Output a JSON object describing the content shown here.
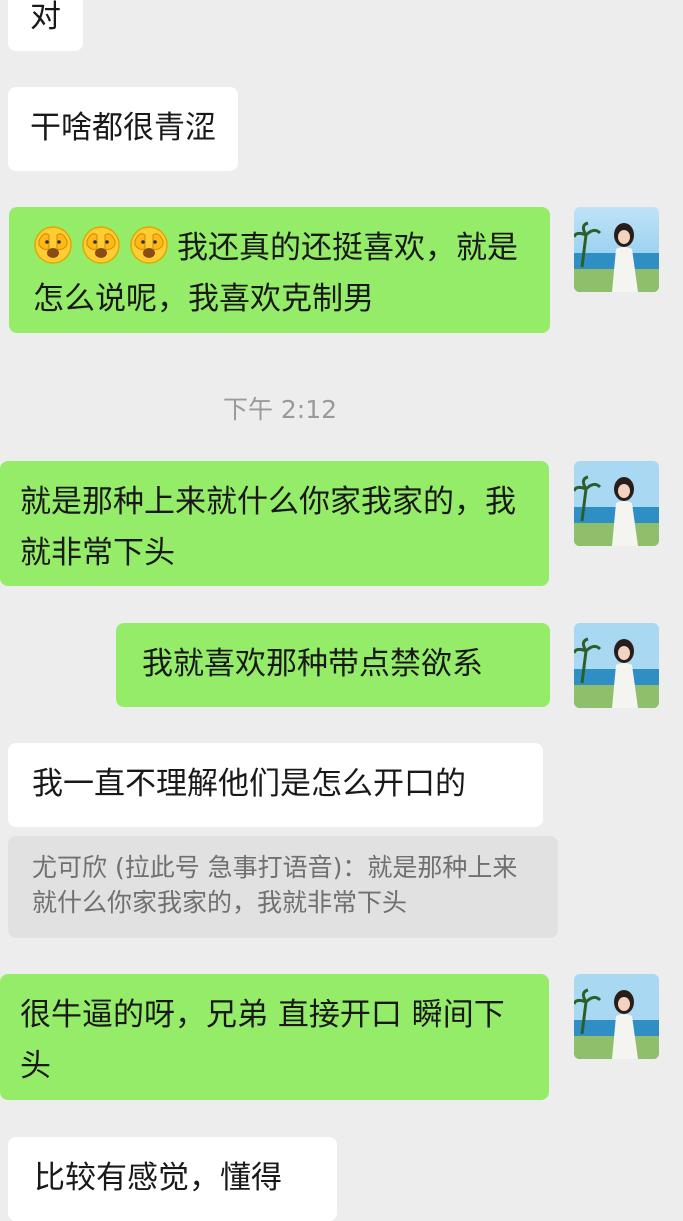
{
  "messages": {
    "m1": "对",
    "m2": "干啥都很青涩",
    "m3_text": "我还真的还挺喜欢，就是怎么说呢，我喜欢克制男",
    "m3_emoji": "face-peeking-emoji",
    "time": "下午 2:12",
    "m4": "就是那种上来就什么你家我家的，我就非常下头",
    "m5": "我就喜欢那种带点禁欲系",
    "m6": "我一直不理解他们是怎么开口的",
    "quote": "尤可欣 (拉此号 急事打语音)：就是那种上来就什么你家我家的，我就非常下头",
    "m7": "很牛逼的呀，兄弟 直接开口 瞬间下头",
    "m8": "比较有感觉，懂得"
  },
  "avatar_icon": "avatar-photo-beach",
  "colors": {
    "background": "#ededed",
    "sent_bubble": "#95ec69",
    "received_bubble": "#ffffff",
    "quote_bubble": "#e1e1e1"
  }
}
